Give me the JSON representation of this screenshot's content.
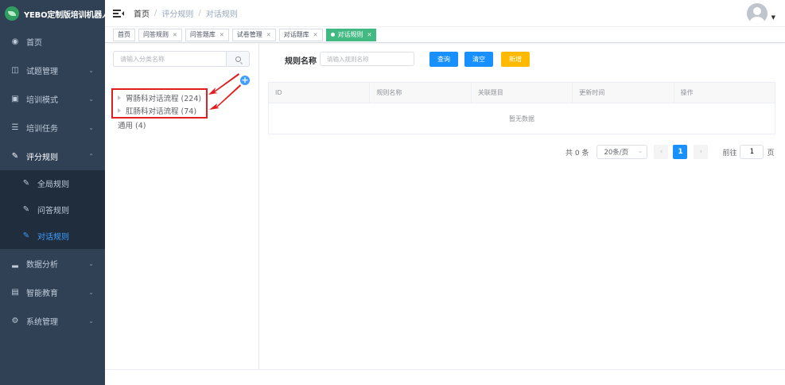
{
  "app": {
    "title": "YEBO定制版培训机器人"
  },
  "sidebar": {
    "items": [
      {
        "label": "首页",
        "icon": "dashboard-icon"
      },
      {
        "label": "试题管理",
        "icon": "document-icon"
      },
      {
        "label": "培训模式",
        "icon": "monitor-icon"
      },
      {
        "label": "培训任务",
        "icon": "list-icon"
      },
      {
        "label": "评分规则",
        "icon": "edit-icon"
      },
      {
        "label": "数据分析",
        "icon": "bar-chart-icon"
      },
      {
        "label": "智能教育",
        "icon": "screen-icon"
      },
      {
        "label": "系统管理",
        "icon": "gear-icon"
      }
    ],
    "submenu": [
      {
        "label": "全局规则"
      },
      {
        "label": "问答规则"
      },
      {
        "label": "对话规则"
      }
    ],
    "active_color": "#409eff"
  },
  "breadcrumb": {
    "items": [
      "首页",
      "评分规则",
      "对话规则"
    ],
    "separator": "/"
  },
  "tags": [
    {
      "label": "首页"
    },
    {
      "label": "问答规则"
    },
    {
      "label": "问答题库"
    },
    {
      "label": "试卷管理"
    },
    {
      "label": "对话题库"
    },
    {
      "label": "对话规则"
    }
  ],
  "left_panel": {
    "search_placeholder": "请输入分类名称",
    "add_symbol": "+",
    "tree": [
      {
        "label": "胃肠科对话流程 (224)"
      },
      {
        "label": "肛肠科对话流程 (74)"
      },
      {
        "label": "通用 (4)"
      }
    ]
  },
  "filter": {
    "label": "规则名称",
    "placeholder": "请输入规则名称",
    "query_label": "查询",
    "clear_label": "清空",
    "add_label": "新增"
  },
  "table": {
    "columns": [
      "ID",
      "规则名称",
      "关联题目",
      "更新时间",
      "操作"
    ],
    "empty_text": "暂无数据"
  },
  "pagination": {
    "total_text": "共 0 条",
    "page_size": "20条/页",
    "current_page": "1",
    "goto_prefix": "前往",
    "goto_value": "1",
    "goto_suffix": "页"
  },
  "colors": {
    "sidebar_bg": "#304156",
    "primary": "#1890ff",
    "warning": "#ffba00",
    "active_tag": "#42b983",
    "annotation": "#e02020"
  }
}
